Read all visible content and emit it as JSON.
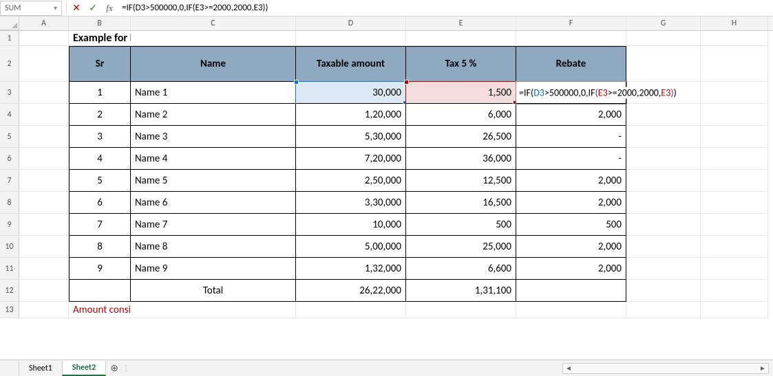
{
  "formula_bar": {
    "name_box": "SUM",
    "formula": "=IF(D3>500000,0,IF(E3>=2000,2000,E3))"
  },
  "cols": [
    "A",
    "B",
    "C",
    "D",
    "E",
    "F",
    "G",
    "H"
  ],
  "rows": [
    "1",
    "2",
    "3",
    "4",
    "5",
    "6",
    "7",
    "8",
    "9",
    "10",
    "11",
    "12",
    "13"
  ],
  "title": "Example for Limit Calculation",
  "headers": {
    "sr": "Sr",
    "name": "Name",
    "taxable": "Taxable amount",
    "tax": "Tax 5 %",
    "rebate": "Rebate"
  },
  "table": [
    {
      "sr": "1",
      "name": "Name 1",
      "taxable": "30,000",
      "tax": "1,500",
      "rebate": ""
    },
    {
      "sr": "2",
      "name": "Name 2",
      "taxable": "1,20,000",
      "tax": "6,000",
      "rebate": "2,000"
    },
    {
      "sr": "3",
      "name": "Name 3",
      "taxable": "5,30,000",
      "tax": "26,500",
      "rebate": "-"
    },
    {
      "sr": "4",
      "name": "Name 4",
      "taxable": "7,20,000",
      "tax": "36,000",
      "rebate": "-"
    },
    {
      "sr": "5",
      "name": "Name 5",
      "taxable": "2,50,000",
      "tax": "12,500",
      "rebate": "2,000"
    },
    {
      "sr": "6",
      "name": "Name 6",
      "taxable": "3,30,000",
      "tax": "16,500",
      "rebate": "2,000"
    },
    {
      "sr": "7",
      "name": "Name 7",
      "taxable": "10,000",
      "tax": "500",
      "rebate": "500"
    },
    {
      "sr": "8",
      "name": "Name 8",
      "taxable": "5,00,000",
      "tax": "25,000",
      "rebate": "2,000"
    },
    {
      "sr": "9",
      "name": "Name 9",
      "taxable": "1,32,000",
      "tax": "6,600",
      "rebate": "2,000"
    }
  ],
  "total": {
    "label": "Total",
    "taxable": "26,22,000",
    "tax": "1,31,100"
  },
  "note": "Amount considered whichever is lesser",
  "editing_formula": {
    "prefix": "=IF",
    "p1o": "(",
    "r1": "D3",
    "m1": ">500000,0,IF",
    "p2o": "(",
    "r2": "E3",
    "m2": ">=2000,2000,",
    "r3": "E3",
    "p2c": ")",
    "p1c": ")"
  },
  "tabs": {
    "sheet1": "Sheet1",
    "sheet2": "Sheet2"
  }
}
